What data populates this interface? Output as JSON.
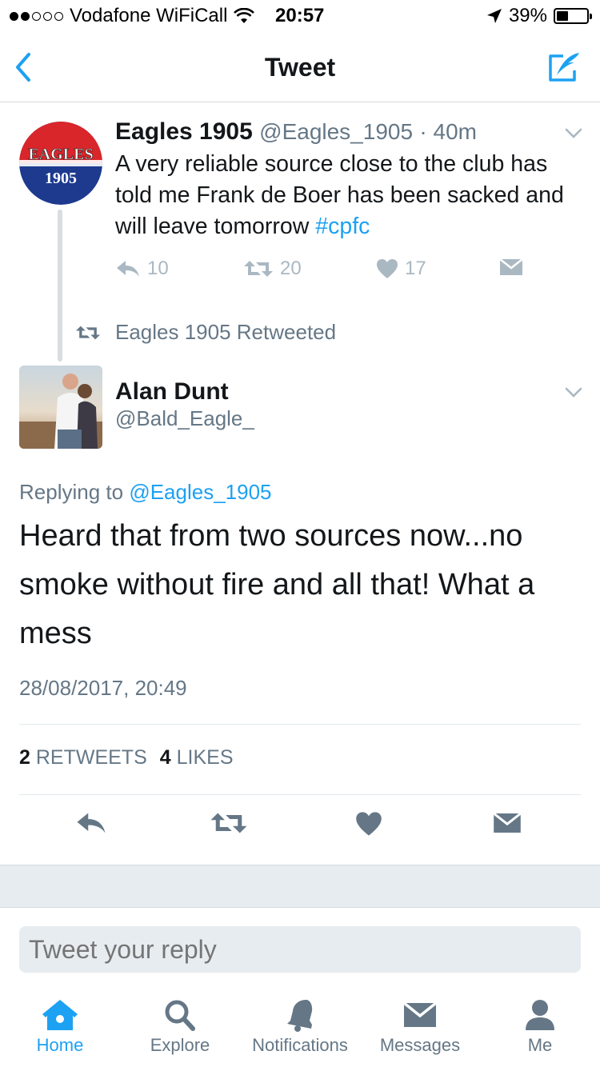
{
  "status_bar": {
    "carrier": "Vodafone WiFiCall",
    "time": "20:57",
    "battery": "39%",
    "battery_level": 0.39
  },
  "nav": {
    "title": "Tweet"
  },
  "tweet1": {
    "avatar_line1": "EAGLES",
    "avatar_line2": "1905",
    "name": "Eagles 1905",
    "handle": "@Eagles_1905",
    "time": "· 40m",
    "text": "A very reliable source close to the club has told me Frank de Boer has been sacked and will leave tomorrow ",
    "hashtag": "#cpfc",
    "replies": "10",
    "retweets": "20",
    "likes": "17"
  },
  "retweeted_label": "Eagles 1905 Retweeted",
  "tweet2": {
    "name": "Alan Dunt",
    "handle": "@Bald_Eagle_",
    "replying_prefix": "Replying to",
    "replying_to": "@Eagles_1905",
    "text": "Heard that from two sources now...no smoke without fire and all that! What a mess",
    "date": "28/08/2017, 20:49",
    "retweet_count": "2",
    "retweet_label": "RETWEETS",
    "like_count": "4",
    "like_label": "LIKES"
  },
  "reply": {
    "placeholder": "Tweet your reply"
  },
  "tabs": [
    {
      "label": "Home",
      "icon": "home-icon",
      "active": true
    },
    {
      "label": "Explore",
      "icon": "search-icon",
      "active": false
    },
    {
      "label": "Notifications",
      "icon": "bell-icon",
      "active": false
    },
    {
      "label": "Messages",
      "icon": "envelope-icon",
      "active": false
    },
    {
      "label": "Me",
      "icon": "person-icon",
      "active": false
    }
  ],
  "colors": {
    "accent": "#1da1f2",
    "muted": "#657786",
    "icon_gray": "#aab8c2",
    "avatar_red": "#d9262b",
    "avatar_blue": "#1d3a8f"
  }
}
